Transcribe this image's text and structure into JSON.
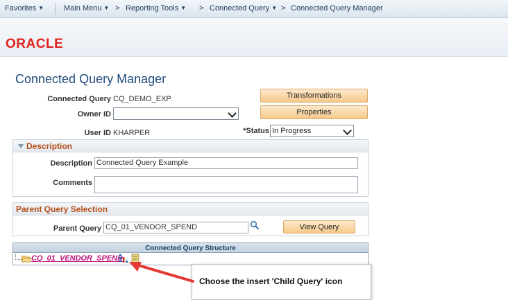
{
  "nav": {
    "favorites": "Favorites",
    "main_menu": "Main Menu",
    "sep": ">",
    "reporting_tools": "Reporting Tools",
    "connected_query": "Connected Query",
    "connected_query_manager": "Connected Query Manager"
  },
  "brand": {
    "logo": "ORACLE"
  },
  "page": {
    "title": "Connected Query Manager"
  },
  "form": {
    "connected_query_label": "Connected Query",
    "connected_query_value": "CQ_DEMO_EXP",
    "owner_id_label": "Owner ID",
    "owner_id_value": "",
    "user_id_label": "User ID",
    "user_id_value": "KHARPER",
    "status_label": "*Status",
    "status_value": "In Progress",
    "transformations_button": "Transformations",
    "properties_button": "Properties"
  },
  "description_section": {
    "title": "Description",
    "description_label": "Description",
    "description_value": "Connected Query Example",
    "comments_label": "Comments",
    "comments_value": ""
  },
  "parent_section": {
    "title": "Parent Query Selection",
    "parent_query_label": "Parent Query",
    "parent_query_value": "CQ_01_VENDOR_SPEND",
    "view_query_button": "View Query"
  },
  "structure": {
    "header": "Connected Query Structure",
    "root_item": "CQ_01_VENDOR_SPEND"
  },
  "callout": {
    "text": "Choose the insert 'Child Query' icon"
  },
  "colors": {
    "accent_orange": "#b4501a",
    "oracle_red": "#e0231c",
    "link_magenta": "#c0127a",
    "arrow_red": "#e53935"
  }
}
